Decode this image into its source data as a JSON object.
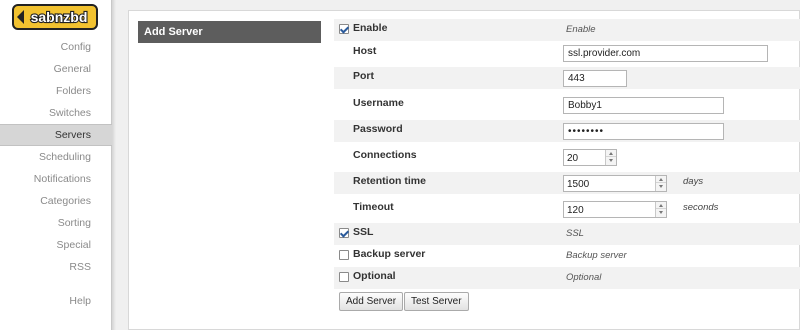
{
  "logo": {
    "text": "sabnzbd",
    "colors": {
      "badge": "#f2c230",
      "outline": "#222222"
    }
  },
  "sidebar": {
    "items": [
      {
        "label": "Config",
        "active": false
      },
      {
        "label": "General",
        "active": false
      },
      {
        "label": "Folders",
        "active": false
      },
      {
        "label": "Switches",
        "active": false
      },
      {
        "label": "Servers",
        "active": true
      },
      {
        "label": "Scheduling",
        "active": false
      },
      {
        "label": "Notifications",
        "active": false
      },
      {
        "label": "Categories",
        "active": false
      },
      {
        "label": "Sorting",
        "active": false
      },
      {
        "label": "Special",
        "active": false
      },
      {
        "label": "RSS",
        "active": false
      }
    ],
    "help": "Help"
  },
  "section": {
    "title": "Add Server"
  },
  "form": {
    "enable": {
      "label": "Enable",
      "checked": true,
      "description": "Enable"
    },
    "host": {
      "label": "Host",
      "value": "ssl.provider.com"
    },
    "port": {
      "label": "Port",
      "value": "443"
    },
    "username": {
      "label": "Username",
      "value": "Bobby1"
    },
    "password": {
      "label": "Password",
      "value": "••••••••"
    },
    "connections": {
      "label": "Connections",
      "value": "20"
    },
    "retention": {
      "label": "Retention time",
      "value": "1500",
      "unit": "days"
    },
    "timeout": {
      "label": "Timeout",
      "value": "120",
      "unit": "seconds"
    },
    "ssl": {
      "label": "SSL",
      "checked": true,
      "description": "SSL"
    },
    "backup": {
      "label": "Backup server",
      "checked": false,
      "description": "Backup server"
    },
    "optional": {
      "label": "Optional",
      "checked": false,
      "description": "Optional"
    }
  },
  "buttons": {
    "add_server": "Add Server",
    "test_server": "Test Server"
  },
  "colors": {
    "header_bg": "#5d5d5d",
    "active_nav_bg": "#d6d6d6",
    "row_shade": "#f2f2f2",
    "checkmark": "#2a5a9b"
  }
}
